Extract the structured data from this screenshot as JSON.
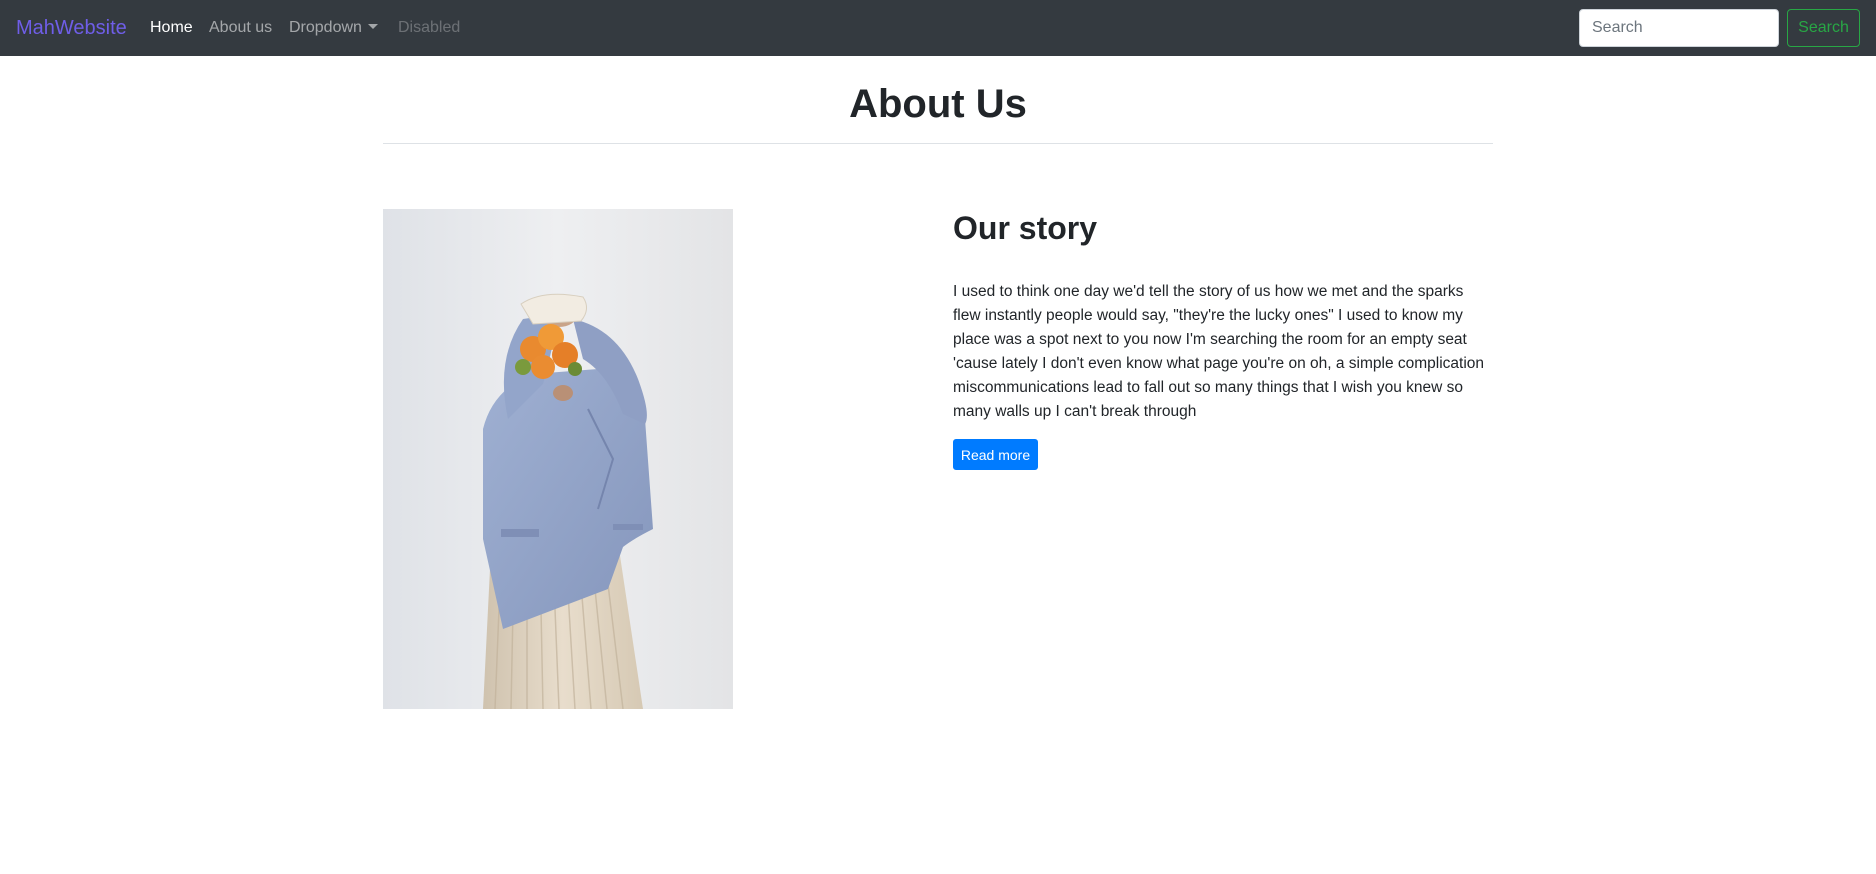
{
  "navbar": {
    "brand": "MahWebsite",
    "links": [
      {
        "label": "Home"
      },
      {
        "label": "About us"
      },
      {
        "label": "Dropdown"
      },
      {
        "label": "Disabled"
      }
    ],
    "search": {
      "placeholder": "Search",
      "value": "",
      "button_label": "Search"
    }
  },
  "header": {
    "title": "About Us"
  },
  "story": {
    "heading": "Our story",
    "body": "I used to think one day we'd tell the story of us how we met and the sparks flew instantly people would say, \"they're the lucky ones\" I used to know my place was a spot next to you now I'm searching the room for an empty seat 'cause lately I don't even know what page you're on oh, a simple complication miscommunications lead to fall out so many things that I wish you knew so many walls up I can't break through",
    "button_label": "Read more"
  },
  "colors": {
    "navbar_bg": "#343a40",
    "brand": "#6f5ee8",
    "search_button": "#28a745",
    "primary_button": "#007bff"
  }
}
